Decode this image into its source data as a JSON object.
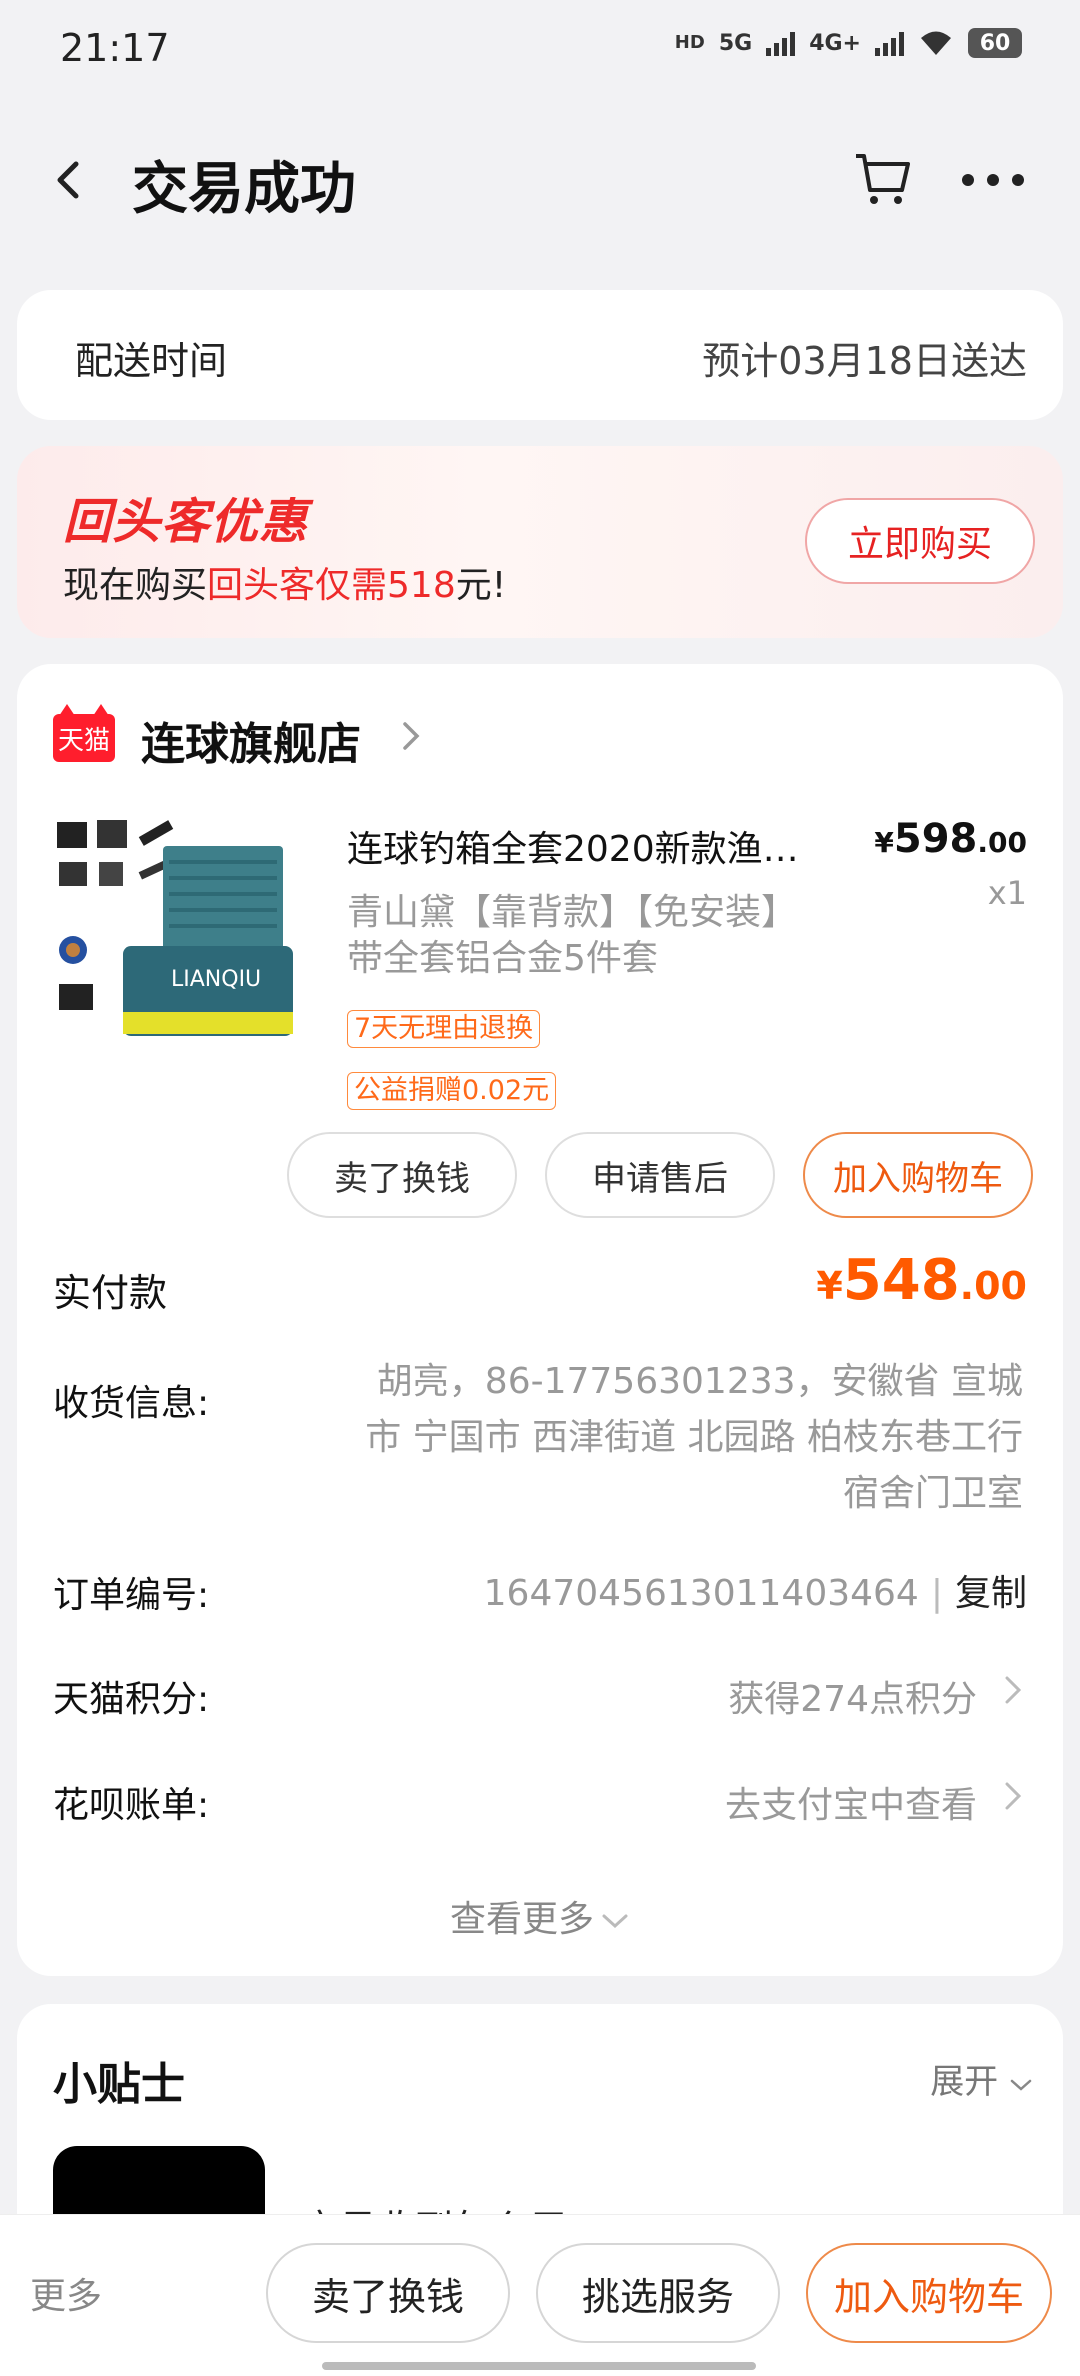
{
  "status_bar": {
    "time": "21:17",
    "network_hd": "HD",
    "network_5g": "5G",
    "network_4g": "4G+",
    "battery": "60"
  },
  "header": {
    "title": "交易成功"
  },
  "delivery": {
    "label": "配送时间",
    "value": "预计03月18日送达"
  },
  "promo": {
    "title": "回头客优惠",
    "subtitle_prefix": "现在购买",
    "subtitle_highlight": "回头客仅需518",
    "subtitle_suffix": "元!",
    "button_label": "立即购买"
  },
  "shop": {
    "badge": "天猫",
    "name": "连球旗舰店"
  },
  "product": {
    "title": "连球钓箱全套2020新款渔…",
    "sku": "青山黛【靠背款】【免安装】带全套铝合金5件套",
    "price_symbol": "¥",
    "price_int": "598",
    "price_dec": ".00",
    "quantity": "x1",
    "tags": [
      "7天无理由退换",
      "公益捐赠0.02元"
    ]
  },
  "order_actions": {
    "sell": "卖了换钱",
    "aftersale": "申请售后",
    "add_cart": "加入购物车"
  },
  "payment": {
    "label": "实付款",
    "symbol": "¥",
    "int": "548",
    "dec": ".00"
  },
  "address": {
    "label": "收货信息:",
    "value": "胡亮，86-17756301233，安徽省 宣城市 宁国市 西津街道 北园路 柏枝东巷工行宿舍门卫室"
  },
  "order_no": {
    "label": "订单编号:",
    "value": "1647045613011403464",
    "separator": "|",
    "copy": "复制"
  },
  "points": {
    "label": "天猫积分:",
    "value": "获得274点积分"
  },
  "huabei": {
    "label": "花呗账单:",
    "value": "去支付宝中查看"
  },
  "see_more": "查看更多",
  "tips": {
    "title": "小贴士",
    "expand": "展开",
    "item_text": "宝贝收到怎么用"
  },
  "bottom_bar": {
    "more": "更多",
    "sell": "卖了换钱",
    "service": "挑选服务",
    "add_cart": "加入购物车"
  }
}
